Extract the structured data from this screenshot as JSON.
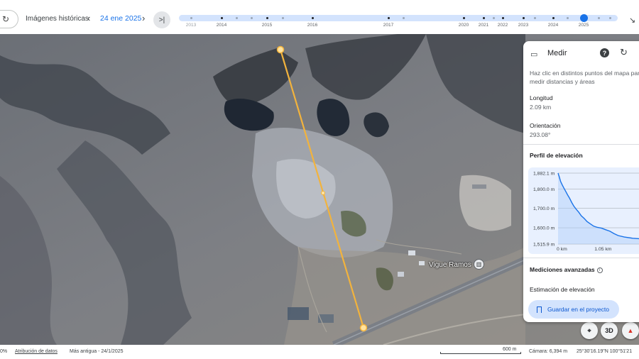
{
  "toolbar": {
    "rotate_icon": "rotate-icon",
    "historical_label": "Imágenes históricas",
    "prev_icon": "chevron-left-icon",
    "date": "24 ene 2025",
    "next_icon": "chevron-right-icon",
    "latest_icon": "skip-to-latest-icon",
    "latest_glyph": ">|",
    "compress_icon": "compress-icon",
    "timeline_years": [
      "2013",
      "2014",
      "2015",
      "2016",
      "2017",
      "2020",
      "2021",
      "2022",
      "2023",
      "2024",
      "2025"
    ],
    "accent_color": "#1a73e8"
  },
  "map": {
    "place_label": "Vigue Ramos",
    "place_icon": "landmark-icon",
    "measure_line_color": "#f2b33d",
    "buttons": {
      "locate_icon": "crosshair-icon",
      "view_3d": "3D",
      "compass_icon": "compass-icon"
    }
  },
  "panel": {
    "title": "Medir",
    "ruler_icon": "ruler-icon",
    "help_icon": "help-icon",
    "reset_icon": "reset-icon",
    "instructions": "Haz clic en distintos puntos del mapa para medir distancias y áreas",
    "length_label": "Longitud",
    "length_value": "2.09 km",
    "heading_label": "Orientación",
    "heading_value": "293.08°",
    "profile_title": "Perfil de elevación",
    "advanced_title": "Mediciones avanzadas",
    "advanced_info_icon": "info-icon",
    "elevation_estimate": "Estimación de elevación",
    "save_label": "Guardar en el proyecto",
    "save_icon": "bookmark-icon"
  },
  "chart_data": {
    "type": "area",
    "title": "Perfil de elevación",
    "y_ticks": [
      "1,882.1 m",
      "1,800.0 m",
      "1,700.0 m",
      "1,600.0 m",
      "1,515.9 m"
    ],
    "x_ticks": [
      "0 km",
      "1.05 km"
    ],
    "ylim": [
      1515.9,
      1882.1
    ],
    "xlim": [
      0,
      2.09
    ],
    "x": [
      0.0,
      0.03,
      0.06,
      0.1,
      0.14,
      0.18,
      0.23,
      0.28,
      0.33,
      0.38,
      0.44,
      0.5,
      0.56,
      0.63,
      0.7,
      0.78,
      0.86,
      0.95,
      1.05,
      1.15,
      1.25,
      1.35,
      1.45,
      1.6,
      1.8,
      2.09
    ],
    "y": [
      1882,
      1862,
      1840,
      1822,
      1805,
      1790,
      1770,
      1752,
      1730,
      1712,
      1695,
      1680,
      1662,
      1648,
      1632,
      1620,
      1608,
      1602,
      1598,
      1590,
      1582,
      1570,
      1560,
      1552,
      1546,
      1541
    ],
    "line_color": "#1a73e8",
    "fill_color": "#aecbfa",
    "grid": true
  },
  "status": {
    "zoom_pct": "0%",
    "attribution": "Atribución de datos",
    "imagery_date": "Más antigua - 24/1/2025",
    "scale_label": "600 m",
    "camera": "Cámara: 6,394 m",
    "coordinates": "25°30'16.19\"N 100°51'21"
  }
}
